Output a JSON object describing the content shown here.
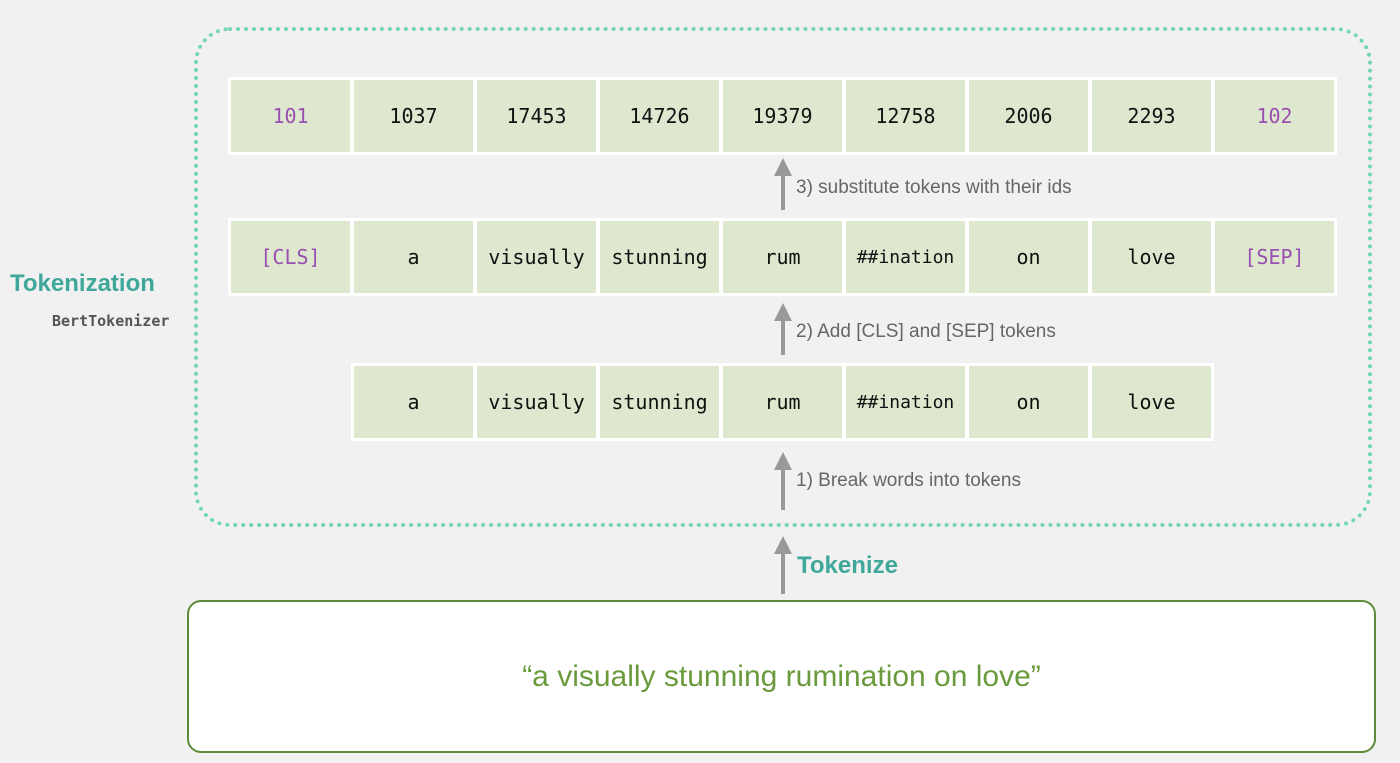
{
  "section": {
    "title": "Tokenization",
    "subtitle": "BertTokenizer"
  },
  "rows": {
    "ids": [
      "101",
      "1037",
      "17453",
      "14726",
      "19379",
      "12758",
      "2006",
      "2293",
      "102"
    ],
    "with_special": [
      "[CLS]",
      "a",
      "visually",
      "stunning",
      "rum",
      "##ination",
      "on",
      "love",
      "[SEP]"
    ],
    "wordpieces": [
      "a",
      "visually",
      "stunning",
      "rum",
      "##ination",
      "on",
      "love"
    ]
  },
  "steps": {
    "step1": "1) Break words into tokens",
    "step2": "2) Add [CLS] and [SEP] tokens",
    "step3": "3) substitute tokens with their ids"
  },
  "tokenize_label": "Tokenize",
  "input_sentence": "“a visually stunning rumination on love”",
  "colors": {
    "cell_fill": "#dde8cf",
    "special_token": "#9a4eb0",
    "teal_accent": "#3fa89a",
    "dotted_border": "#72d8b2",
    "sentence_green": "#6a9a3c"
  }
}
